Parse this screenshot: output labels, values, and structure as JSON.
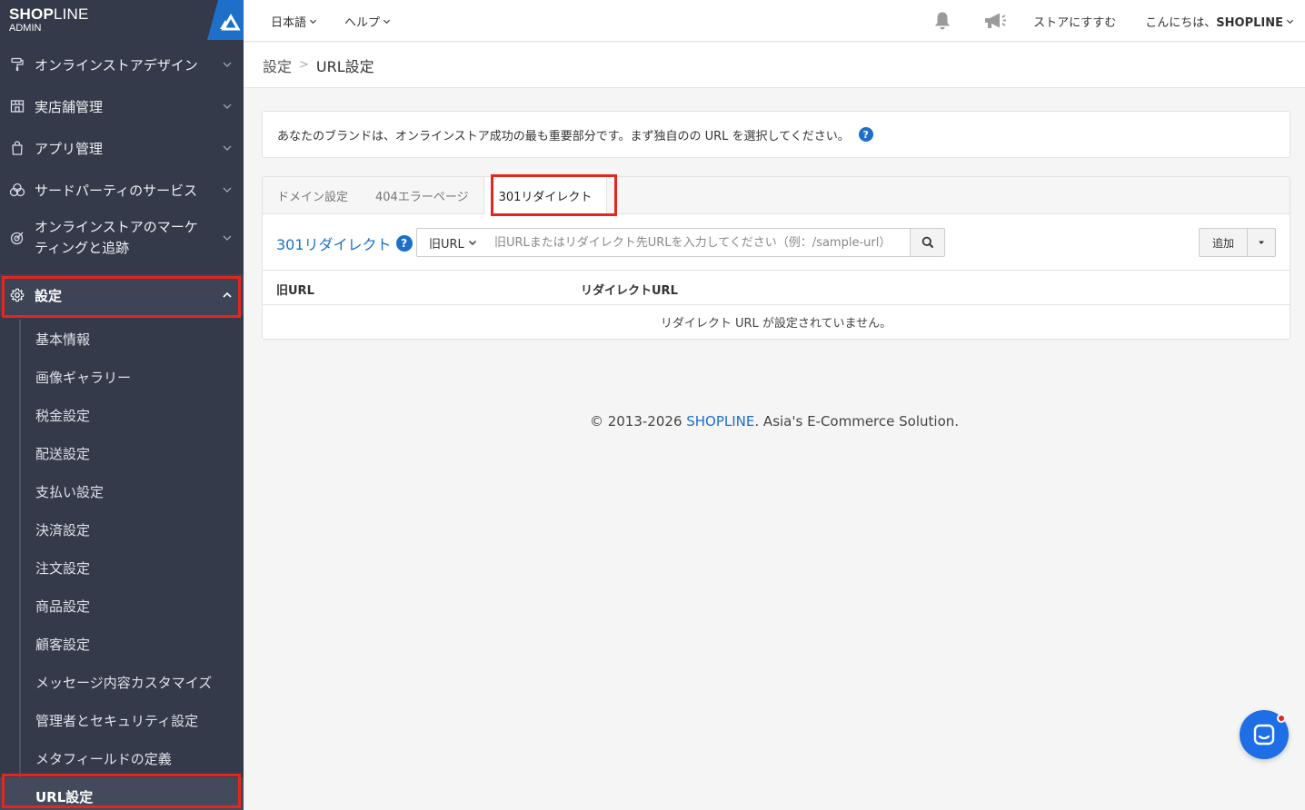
{
  "sidebar": {
    "brand_bold": "SHOP",
    "brand_thin": "LINE",
    "brand_sub": "ADMIN",
    "menu": [
      {
        "label": "オンラインストアデザイン",
        "icon": "paint-roller-icon"
      },
      {
        "label": "実店舗管理",
        "icon": "store-icon"
      },
      {
        "label": "アプリ管理",
        "icon": "shopping-bag-icon"
      },
      {
        "label": "サードパーティのサービス",
        "icon": "circles-icon"
      },
      {
        "label": "オンラインストアのマーケティングと追跡",
        "label_line1": "オンラインストアのマーケ",
        "label_line2": "ティングと追跡",
        "icon": "target-icon"
      },
      {
        "label": "設定",
        "icon": "gear-icon"
      }
    ],
    "submenu": [
      "基本情報",
      "画像ギャラリー",
      "税金設定",
      "配送設定",
      "支払い設定",
      "決済設定",
      "注文設定",
      "商品設定",
      "顧客設定",
      "メッセージ内容カスタマイズ",
      "管理者とセキュリティ設定",
      "メタフィールドの定義",
      "URL設定"
    ]
  },
  "header": {
    "language": "日本語",
    "help": "ヘルプ",
    "store_link": "ストアにすすむ",
    "greeting": "こんにちは、",
    "user": "SHOPLINE"
  },
  "breadcrumb": {
    "parent": "設定",
    "separator": ">",
    "current": "URL設定"
  },
  "notice": {
    "text": "あなたのブランドは、オンラインストア成功の最も重要部分です。まず独自のの URL を選択してください。",
    "help_glyph": "?"
  },
  "tabs": [
    {
      "label": "ドメイン設定"
    },
    {
      "label": "404エラーページ"
    },
    {
      "label": "301リダイレクト"
    }
  ],
  "toolbar": {
    "title": "301リダイレクト",
    "select_value": "旧URL",
    "search_placeholder": "旧URLまたはリダイレクト先URLを入力してください（例：/sample-url）",
    "add_label": "追加"
  },
  "table": {
    "columns": [
      "旧URL",
      "リダイレクトURL"
    ],
    "empty_text": "リダイレクト URL が設定されていません。"
  },
  "footer": {
    "prefix": "© 2013-2026 ",
    "brand_link": "SHOPLINE",
    "suffix": ". Asia's E-Commerce Solution."
  },
  "colors": {
    "sidebar_bg": "#343a4a",
    "accent_blue": "#1d6fc9",
    "highlight_red": "#e5261f",
    "chat_blue": "#1e6fe6"
  }
}
